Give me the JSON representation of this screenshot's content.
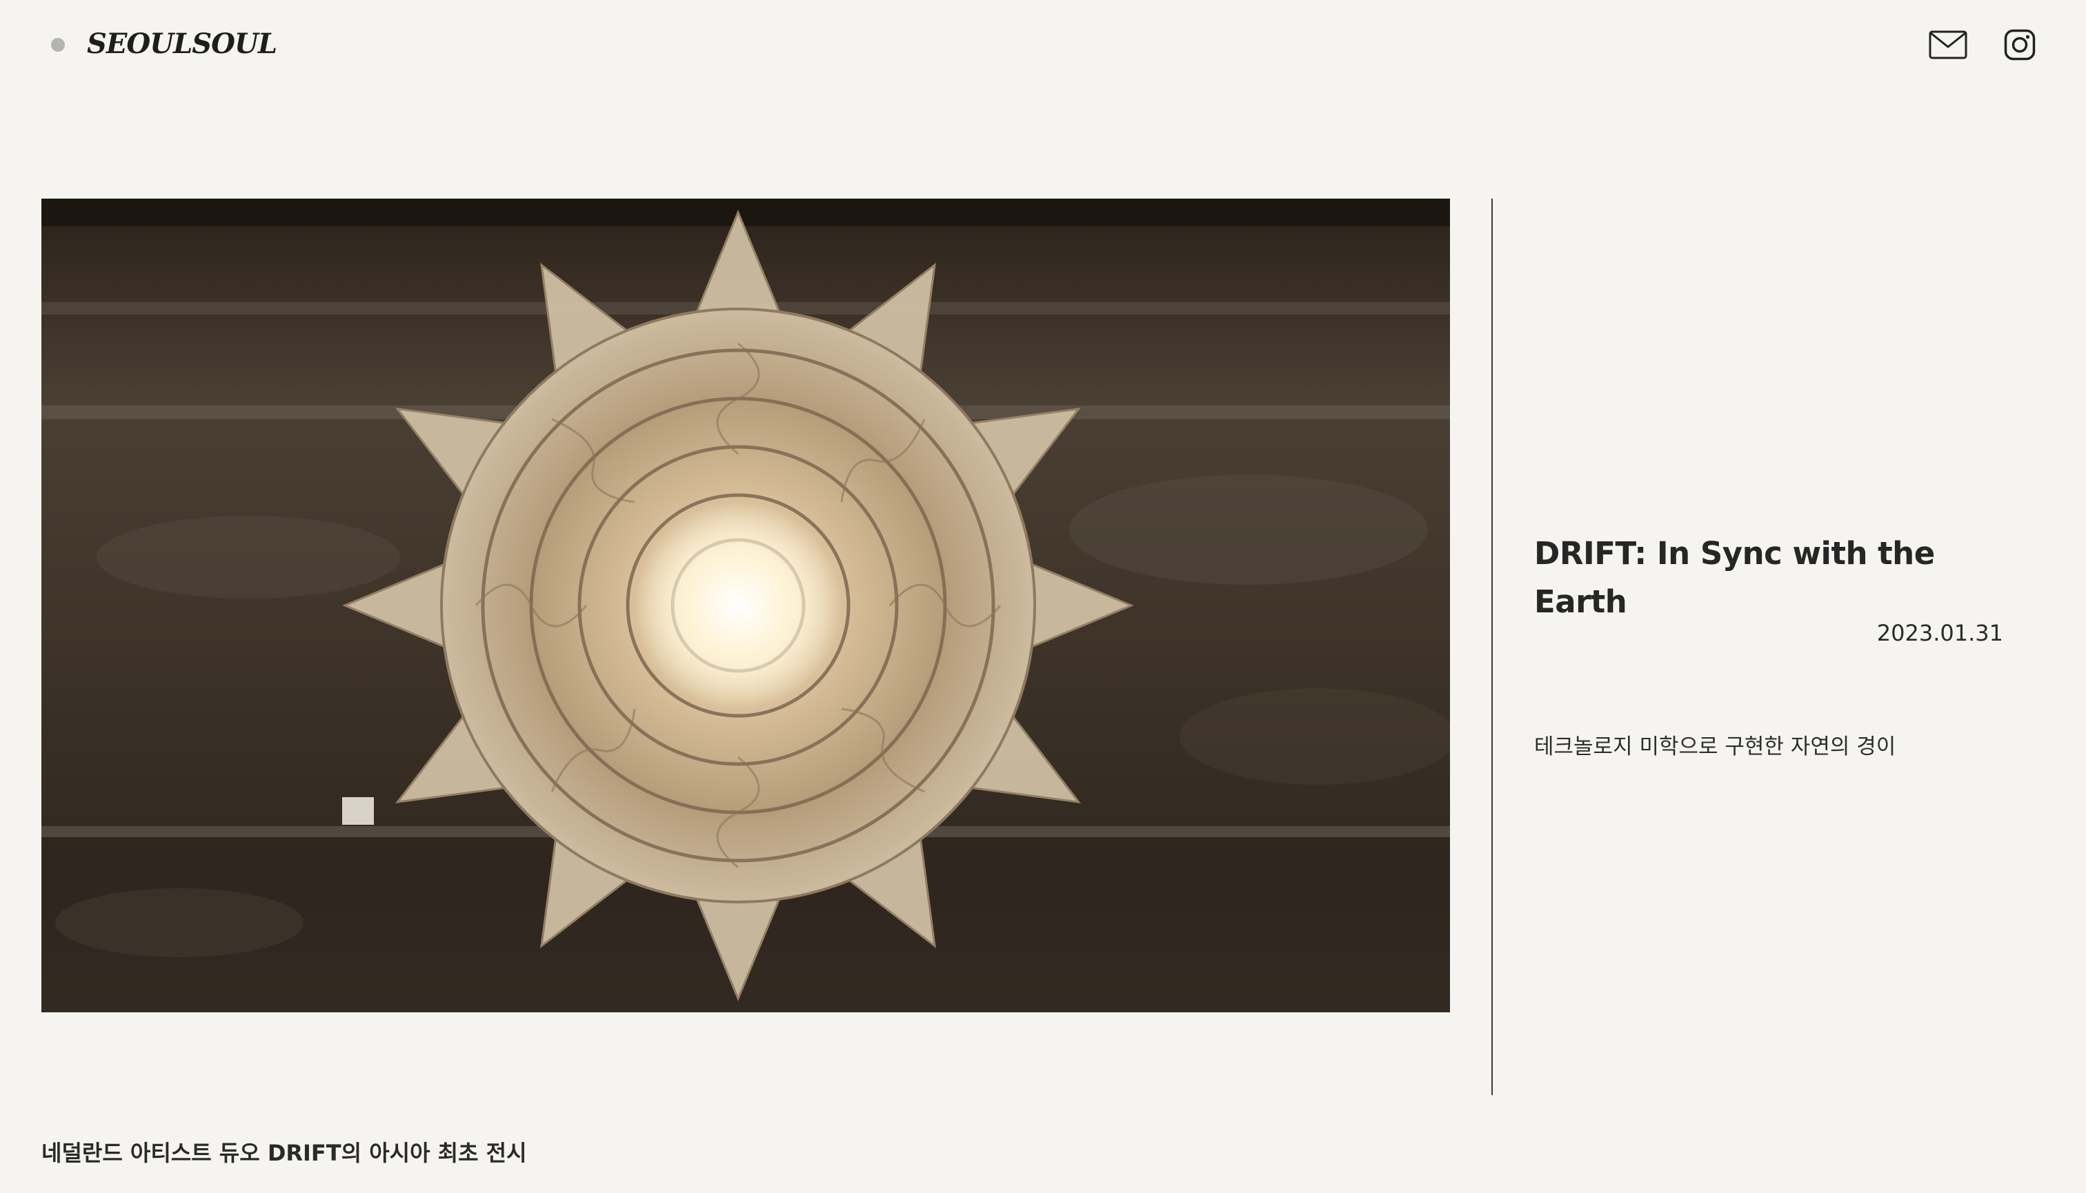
{
  "header": {
    "logo": "SEOULSOUL",
    "icons": [
      "mail-icon",
      "instagram-icon"
    ]
  },
  "hero": {
    "subject": "illuminated-flower-sculpture-image"
  },
  "article": {
    "title": "DRIFT: In Sync with the Earth",
    "date": "2023.01.31",
    "subtitle": "테크놀로지 미학으로 구현한 자연의 경이"
  },
  "caption": {
    "text": "네덜란드 아티스트 듀오 DRIFT의 아시아 최초 전시"
  },
  "colors": {
    "background": "#f5f4f0",
    "text": "#2b2b2b",
    "divider": "#3a3a3a",
    "dot": "#b4b4b4"
  }
}
